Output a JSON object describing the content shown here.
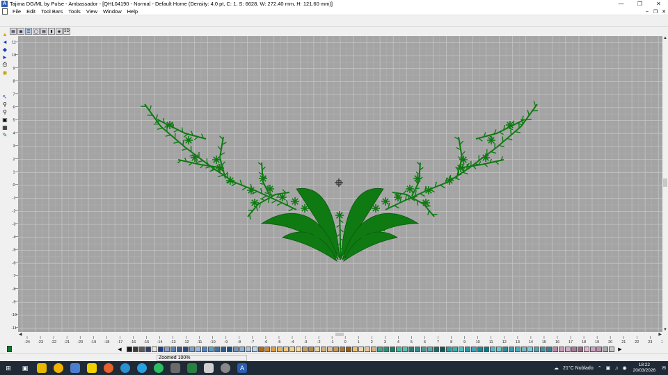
{
  "window": {
    "title": "Tajima DG/ML by Pulse - Ambassador - [QHL04190 - Normal - Default Home (Density: 4.0 pt, C: 1, S: 6628, W: 272.40 mm, H: 121.60 mm)]",
    "app_icon_letter": "A"
  },
  "menu": [
    "File",
    "Edit",
    "Tool Bars",
    "Tools",
    "View",
    "Window",
    "Help"
  ],
  "view_toolbar": [
    "3D"
  ],
  "rulers": {
    "vertical": [
      "11",
      "10",
      "9",
      "8",
      "7",
      "6",
      "5",
      "4",
      "3",
      "2",
      "1",
      "0",
      "-1",
      "-2",
      "-3",
      "-4",
      "-5",
      "-6",
      "-7",
      "-8",
      "-9",
      "-10",
      "-11"
    ],
    "horizontal": [
      "-24",
      "-23",
      "-22",
      "-21",
      "-20",
      "-19",
      "-18",
      "-17",
      "-16",
      "-15",
      "-14",
      "-13",
      "-12",
      "-11",
      "-10",
      "-9",
      "-8",
      "-7",
      "-6",
      "-5",
      "-4",
      "-3",
      "-2",
      "-1",
      "0",
      "1",
      "2",
      "3",
      "4",
      "5",
      "6",
      "7",
      "8",
      "9",
      "10",
      "11",
      "12",
      "13",
      "14",
      "15",
      "16",
      "17",
      "18",
      "19",
      "20",
      "21",
      "22",
      "23",
      "24"
    ]
  },
  "design": {
    "thread_color": "#0f7a12",
    "canvas_color": "#a4a4a4"
  },
  "palette": {
    "active_color": "#0a7a2e",
    "colors": [
      "#1a1a1a",
      "#3a3a3a",
      "#5a5a5a",
      "#2b3f66",
      "#e6e6e6",
      "#1b3f8f",
      "#8a9fc0",
      "#5b7fb5",
      "#3c5a8a",
      "#2a4a7a",
      "#7aa0d0",
      "#9ab8de",
      "#4f86c0",
      "#5aa0d0",
      "#3f6f9f",
      "#2d5f8f",
      "#1d4f7f",
      "#6f93bb",
      "#8fb0d3",
      "#a9c3e0",
      "#c0d4ea",
      "#b06a1a",
      "#d08a2a",
      "#e0a040",
      "#e8b860",
      "#f0c878",
      "#f3d28a",
      "#f5dca0",
      "#c8a060",
      "#b08a50",
      "#e8d4a0",
      "#d4b078",
      "#e0c090",
      "#c89858",
      "#a87838",
      "#906020",
      "#ecc070",
      "#f0d8a8",
      "#e8c898",
      "#dcb080",
      "#3aa890",
      "#2a9070",
      "#1a8060",
      "#48b8a0",
      "#58c0b0",
      "#2a7878",
      "#3a8888",
      "#4a9898",
      "#5aa8a8",
      "#1a6a6a",
      "#0a5a5a",
      "#2aa0a0",
      "#38b0b0",
      "#48c0c0",
      "#2898a8",
      "#3aa8b8",
      "#188898",
      "#0a7888",
      "#58b8c8",
      "#68c8d0",
      "#2a8a9a",
      "#3a9aaa",
      "#4aaab8",
      "#6abac8",
      "#7acad8",
      "#58a0b0",
      "#4890a0",
      "#388090",
      "#b888a8",
      "#c898b8",
      "#d8a8c8",
      "#a87898",
      "#986888",
      "#e0b8d0",
      "#d0a0c0",
      "#c090b0",
      "#a8a8a8",
      "#c8c8c8"
    ]
  },
  "status": {
    "zoom": "Zoomed 100%"
  },
  "taskbar": {
    "weather": "21°C  Nublado",
    "time": "18:22",
    "date": "20/03/2026"
  }
}
